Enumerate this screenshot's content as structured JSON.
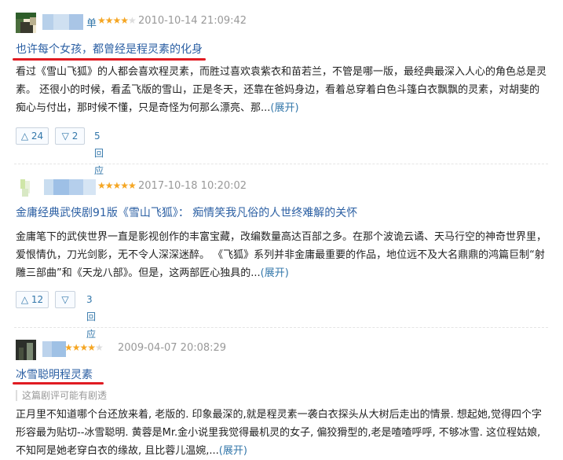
{
  "reviews": [
    {
      "user": "单",
      "rating": 4,
      "rating_stars_on": "★★★★",
      "rating_stars_off": "★",
      "date": "2010-10-14 21:09:42",
      "title": "也许每个女孩，都曾经是程灵素的化身",
      "body": "看过《雪山飞狐》的人都会喜欢程灵素，而胜过喜欢袁紫衣和苗若兰，不管是哪一版，最经典最深入人心的角色总是灵素。 还很小的时候，看孟飞版的雪山，正是冬天，还靠在爸妈身边，看着总穿着白色斗篷白衣飘飘的灵素，对胡斐的痴心与付出，那时候不懂，只是奇怪为何那么漂亮、那...",
      "expand": "(展开)",
      "up_icon": "△",
      "up_count": "24",
      "down_icon": "▽",
      "down_count": "2",
      "replies": "5回应"
    },
    {
      "user": "",
      "rating": 5,
      "rating_stars_on": "★★★★★",
      "rating_stars_off": "",
      "date": "2017-10-18 10:20:02",
      "title": "金庸经典武侠剧91版《雪山飞狐》： 痴情笑我凡俗的人世终难解的关怀",
      "body": "金庸笔下的武侠世界一直是影视创作的丰富宝藏，改编数量高达百部之多。在那个波诡云谲、天马行空的神奇世界里，爱恨情仇，刀光剑影，无不令人深深迷醉。 《飞狐》系列并非金庸最重要的作品，地位远不及大名鼎鼎的鸿篇巨制“射雕三部曲”和《天龙八部》。但是，这两部匠心独具的...",
      "expand": "(展开)",
      "up_icon": "△",
      "up_count": "12",
      "down_icon": "▽",
      "down_count": "",
      "replies": "3回应"
    },
    {
      "user": "",
      "rating": 4,
      "rating_stars_on": "★★★★",
      "rating_stars_off": "★",
      "date": "2009-04-07 20:08:29",
      "title": "冰雪聪明程灵素",
      "spoiler": "这篇剧评可能有剧透",
      "body": "正月里不知道哪个台还放来着, 老版的. 印象最深的,就是程灵素一袭白衣探头从大树后走出的情景. 想起她,觉得四个字形容最为贴切--冰雪聪明. 黄蓉是Mr.金小说里我觉得最机灵的女子, 偏狡猾型的,老是喳喳呼呼, 不够冰雪. 这位程姑娘,不知阿是她老穿白衣的缘故, 且比蓉儿温婉,...",
      "expand": "(展开)"
    }
  ],
  "colors": {
    "link": "#2b5fa3",
    "star": "#f5a623",
    "underline": "#e01b22",
    "date": "#999999"
  }
}
